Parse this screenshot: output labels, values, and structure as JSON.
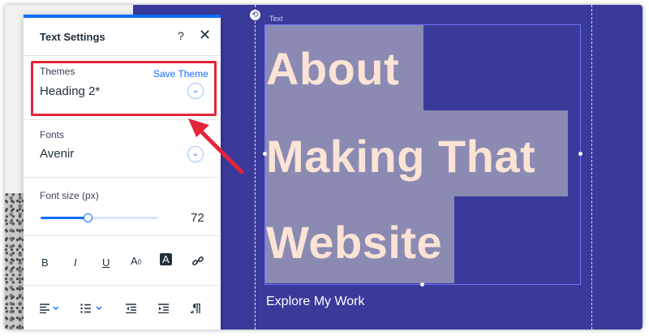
{
  "panel": {
    "title": "Text Settings",
    "help_icon": "?",
    "close_icon": "✕",
    "themes_label": "Themes",
    "save_theme_label": "Save Theme",
    "themes_value": "Heading 2*",
    "fonts_label": "Fonts",
    "fonts_value": "Avenir",
    "font_size_label": "Font size (px)",
    "font_size_value": "72",
    "font_size_fraction": 0.4,
    "toolbar": {
      "bold": "B",
      "italic": "I",
      "underline": "U",
      "text_color": "A",
      "highlight_color": "A",
      "link_icon": "link-icon"
    },
    "bottom_toolbar": {
      "align_icon": "align-left-icon",
      "list_icon": "bullet-list-icon",
      "indent_decrease_icon": "indent-decrease-icon",
      "indent_increase_icon": "indent-increase-icon",
      "text_direction_icon": "text-direction-icon"
    }
  },
  "canvas": {
    "element_label": "Text",
    "heading_lines": [
      "About",
      "Making That",
      "Website"
    ],
    "explore_text": "Explore My Work",
    "background_color": "#3a3a9b",
    "heading_color": "#fbe3d5",
    "highlight_color": "#8b8ab3"
  },
  "annotation": {
    "highlight_color": "#e3243a"
  }
}
